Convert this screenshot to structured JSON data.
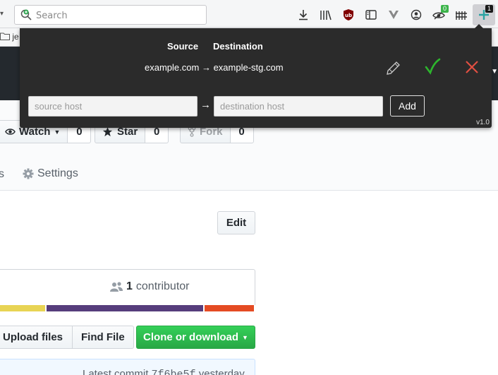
{
  "browser": {
    "search_placeholder": "Search",
    "bookmark_folder_fragment": "je",
    "toolbar_badges": {
      "extension_active": "1",
      "green_badge": "0"
    },
    "toolbar_icons": [
      "download-icon",
      "library-icon",
      "ublock-icon",
      "reader-sidebar-icon",
      "vivaldi-v-icon",
      "account-icon",
      "eye-slash-badge-icon",
      "fence-icon",
      "host-rewrite-extension-icon"
    ]
  },
  "popup": {
    "source_header": "Source",
    "destination_header": "Destination",
    "rules": [
      {
        "source": "example.com",
        "arrow": "→",
        "destination": "example-stg.com"
      }
    ],
    "source_placeholder": "source host",
    "destination_placeholder": "destination host",
    "arrow": "→",
    "add_label": "Add",
    "version": "v1.0",
    "colors": {
      "check": "#2db52d",
      "delete": "#e14f42"
    }
  },
  "repo": {
    "watch_label": "Watch",
    "watch_count": "0",
    "star_label": "Star",
    "star_count": "0",
    "fork_label": "Fork",
    "fork_count": "0",
    "tab_left_fragment": "s",
    "settings_label": "Settings",
    "edit_label": "Edit",
    "contributor_count": "1",
    "contributor_label": "contributor",
    "languages": [
      {
        "color": "#e8d454",
        "share": 0.177
      },
      {
        "color": "#563d7c",
        "share": 0.622
      },
      {
        "color": "#e44b23",
        "share": 0.201
      }
    ],
    "upload_label": "Upload files",
    "find_label": "Find File",
    "clone_label": "Clone or download",
    "commit_prefix": "Latest commit",
    "commit_sha": "7f6be5f",
    "commit_time": "yesterday"
  }
}
